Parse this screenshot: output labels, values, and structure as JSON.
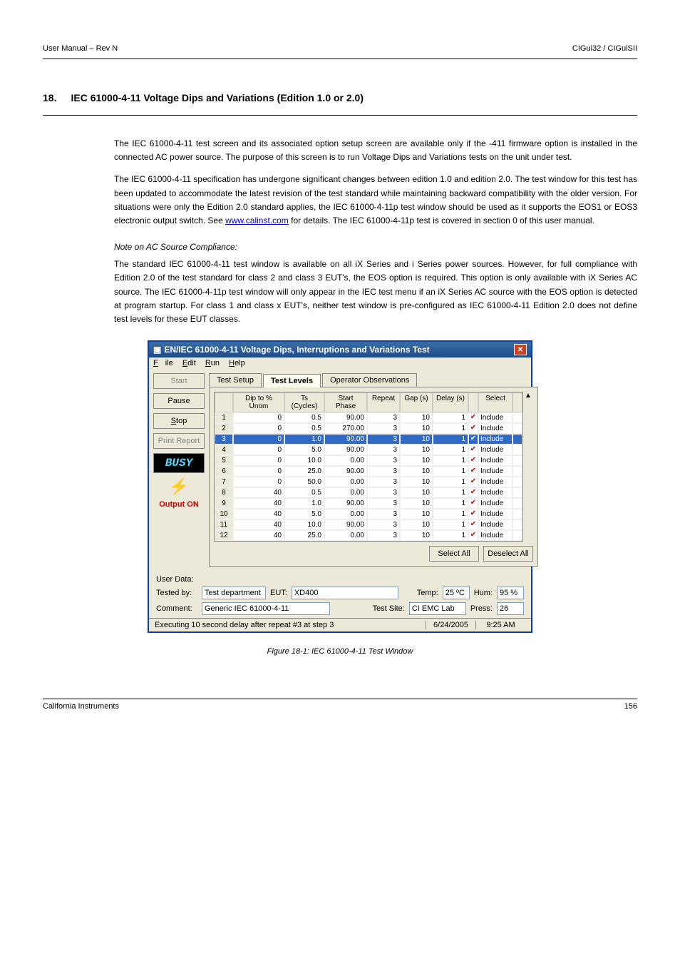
{
  "header": {
    "left": "User Manual – Rev N",
    "right": "CIGui32 / CIGuiSII"
  },
  "section": {
    "number": "18.",
    "title": "IEC 61000-4-11 Voltage Dips and Variations (Edition 1.0 or 2.0)",
    "p1": "The IEC 61000-4-11 test screen and its associated option setup screen are available only if the -411 firmware option is installed in the connected AC power source. The purpose of this screen is to run Voltage Dips and Variations tests on the unit under test.",
    "p2_a": "The IEC 61000-4-11 specification has undergone significant changes between edition 1.0 and edition 2.0. The test window for this test has been updated to accommodate the latest revision of the test standard while maintaining backward compatibility with the older version. For situations were only the Edition 2.0 standard applies, the IEC 61000-4-11p test window should be used as it supports the EOS1 or EOS3 electronic output switch. See ",
    "p2_link": "www.calinst.com",
    "p2_b": " for details. The IEC 61000-4-11p test is covered in section 0 of this user manual.",
    "p3_head": "Note on AC Source Compliance:",
    "p3_body": "The standard IEC 61000-4-11 test window is available on all iX Series and i Series power sources. However, for full compliance with Edition 2.0 of the test standard for class 2 and class 3 EUT's, the EOS option is required. This option is only available with iX Series AC source. The IEC 61000-4-11p test window will only appear in the IEC test menu if an iX Series AC source with the EOS option is detected at program startup. For class 1 and class x EUT's, neither test window is pre-configured as IEC 61000-4-11 Edition 2.0 does not define test levels for these EUT classes."
  },
  "dialog": {
    "title": "EN/IEC 61000-4-11 Voltage Dips, Interruptions and Variations Test",
    "menus": [
      "File",
      "Edit",
      "Run",
      "Help"
    ],
    "buttons": {
      "start": "Start",
      "pause": "Pause",
      "stop": "Stop",
      "print": "Print Report"
    },
    "busy": "BUSY",
    "output_on": "Output ON",
    "tabs": [
      "Test Setup",
      "Test Levels",
      "Operator Observations"
    ],
    "active_tab": 1,
    "columns": [
      "",
      "Dip to % Unom",
      "Ts (Cycles)",
      "Start Phase",
      "Repeat",
      "Gap (s)",
      "Delay (s)",
      "",
      "Select",
      ""
    ],
    "rows": [
      {
        "n": 1,
        "dip": 0,
        "ts": "0.5",
        "ph": "90.00",
        "rep": 3,
        "gap": 10,
        "del": 1,
        "inc": "Include"
      },
      {
        "n": 2,
        "dip": 0,
        "ts": "0.5",
        "ph": "270.00",
        "rep": 3,
        "gap": 10,
        "del": 1,
        "inc": "Include"
      },
      {
        "n": 3,
        "dip": 0,
        "ts": "1.0",
        "ph": "90.00",
        "rep": 3,
        "gap": 10,
        "del": 1,
        "inc": "Include",
        "sel": true
      },
      {
        "n": 4,
        "dip": 0,
        "ts": "5.0",
        "ph": "90.00",
        "rep": 3,
        "gap": 10,
        "del": 1,
        "inc": "Include"
      },
      {
        "n": 5,
        "dip": 0,
        "ts": "10.0",
        "ph": "0.00",
        "rep": 3,
        "gap": 10,
        "del": 1,
        "inc": "Include"
      },
      {
        "n": 6,
        "dip": 0,
        "ts": "25.0",
        "ph": "90.00",
        "rep": 3,
        "gap": 10,
        "del": 1,
        "inc": "Include"
      },
      {
        "n": 7,
        "dip": 0,
        "ts": "50.0",
        "ph": "0.00",
        "rep": 3,
        "gap": 10,
        "del": 1,
        "inc": "Include"
      },
      {
        "n": 8,
        "dip": 40,
        "ts": "0.5",
        "ph": "0.00",
        "rep": 3,
        "gap": 10,
        "del": 1,
        "inc": "Include"
      },
      {
        "n": 9,
        "dip": 40,
        "ts": "1.0",
        "ph": "90.00",
        "rep": 3,
        "gap": 10,
        "del": 1,
        "inc": "Include"
      },
      {
        "n": 10,
        "dip": 40,
        "ts": "5.0",
        "ph": "0.00",
        "rep": 3,
        "gap": 10,
        "del": 1,
        "inc": "Include"
      },
      {
        "n": 11,
        "dip": 40,
        "ts": "10.0",
        "ph": "90.00",
        "rep": 3,
        "gap": 10,
        "del": 1,
        "inc": "Include"
      },
      {
        "n": 12,
        "dip": 40,
        "ts": "25.0",
        "ph": "0.00",
        "rep": 3,
        "gap": 10,
        "del": 1,
        "inc": "Include"
      }
    ],
    "select_all": "Select All",
    "deselect_all": "Deselect All",
    "userdata_label": "User Data:",
    "tested_by_label": "Tested by:",
    "tested_by": "Test department",
    "eut_label": "EUT:",
    "eut": "XD400",
    "temp_label": "Temp:",
    "temp": "25 ºC",
    "hum_label": "Hum:",
    "hum": "95 %",
    "comment_label": "Comment:",
    "comment": "Generic IEC 61000-4-11",
    "testsite_label": "Test Site:",
    "testsite": "CI EMC Lab",
    "press_label": "Press:",
    "press": "26",
    "status": "Executing 10 second delay after repeat #3 at step 3",
    "date": "6/24/2005",
    "time": "9:25 AM"
  },
  "caption": "Figure 18-1: IEC 61000-4-11 Test Window",
  "footer": {
    "left": "California Instruments",
    "right": "156"
  }
}
